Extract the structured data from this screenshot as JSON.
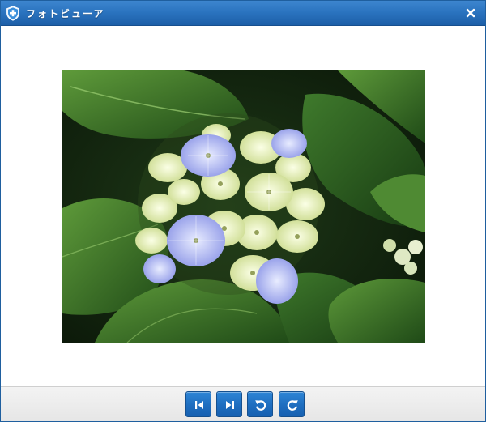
{
  "window": {
    "title": "フォトビューア"
  },
  "icons": {
    "app": "shield-plus-icon",
    "close": "close-icon",
    "previous": "skip-previous-icon",
    "next": "skip-next-icon",
    "rotate_left": "rotate-left-icon",
    "rotate_right": "rotate-right-icon"
  },
  "colors": {
    "titlebar": "#2b74c0",
    "button": "#1f6fc1",
    "toolbar": "#ececec"
  },
  "photo": {
    "subject": "hydrangea-flower"
  }
}
